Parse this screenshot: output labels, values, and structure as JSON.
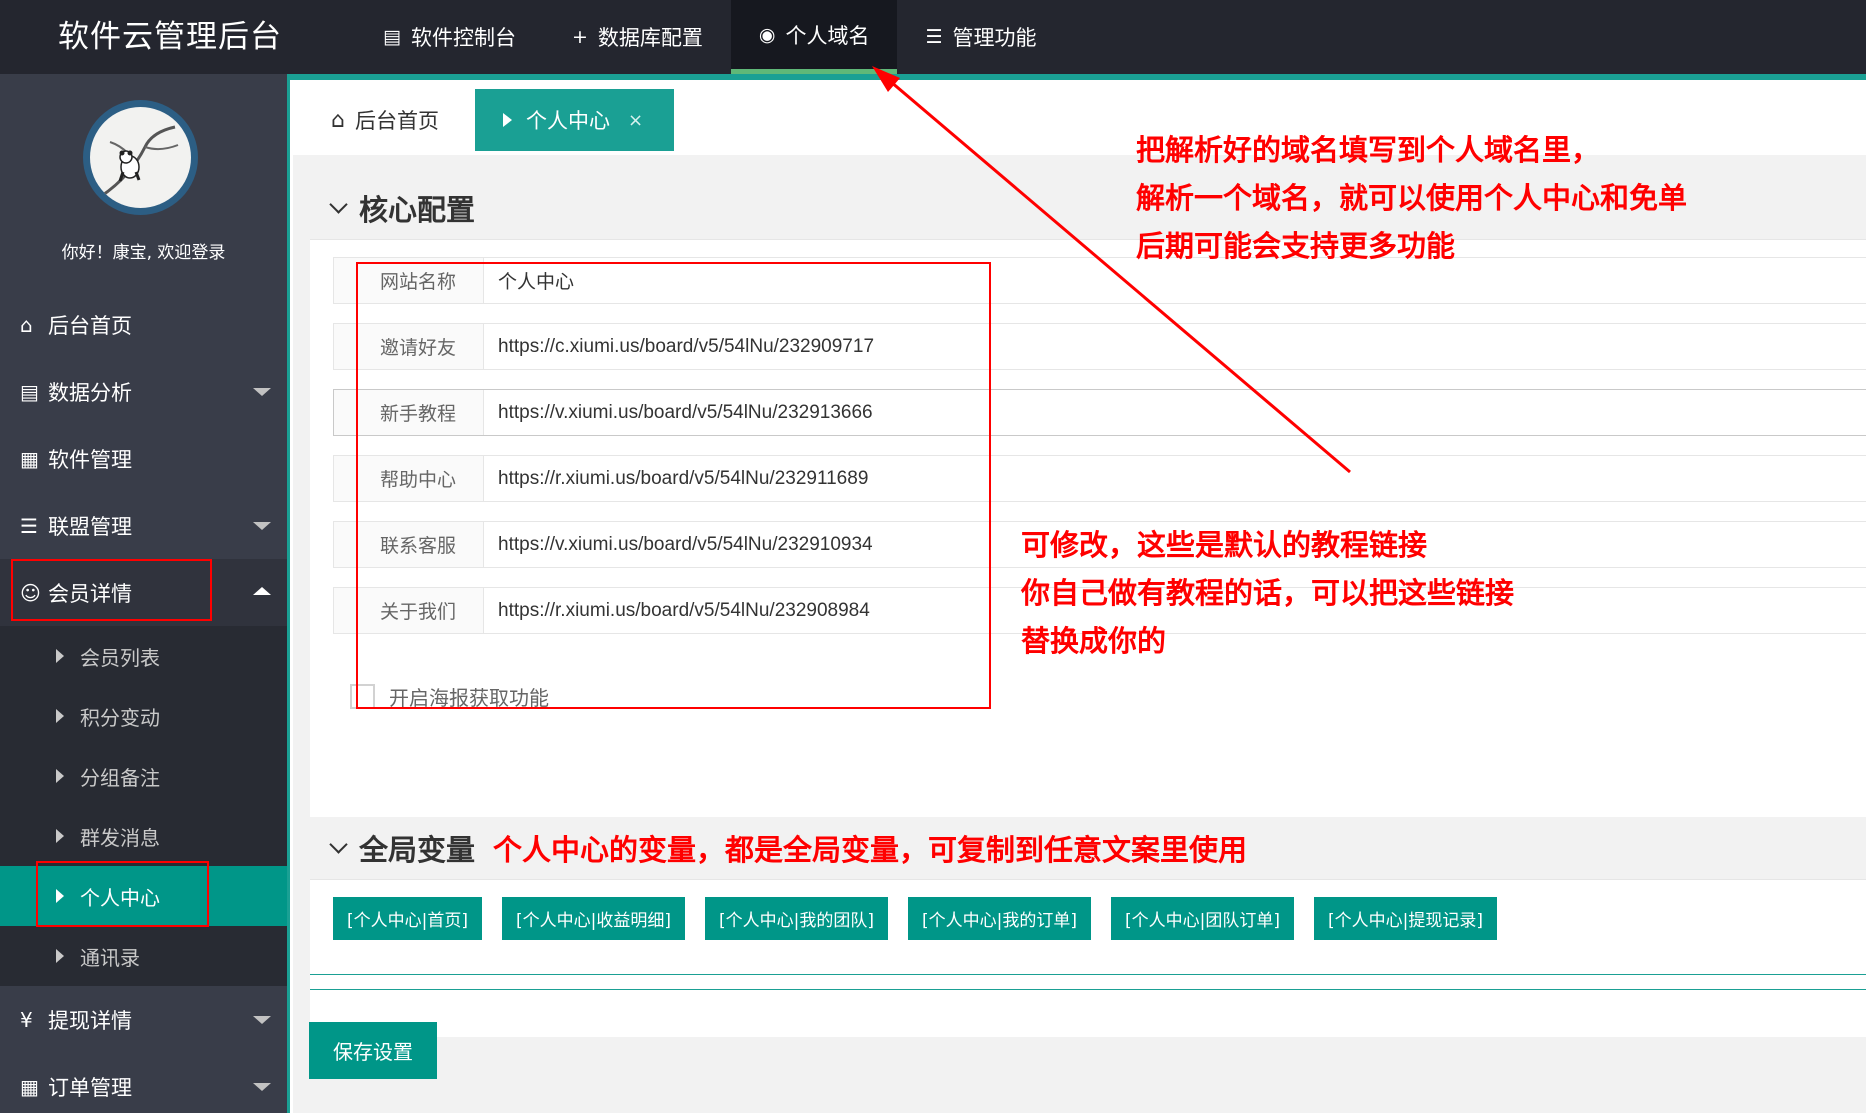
{
  "header": {
    "brand": "软件云管理后台",
    "nav": [
      {
        "icon": "document-icon",
        "label": "软件控制台"
      },
      {
        "icon": "plus-icon",
        "label": "数据库配置"
      },
      {
        "icon": "globe-icon",
        "label": "个人域名",
        "active": true
      },
      {
        "icon": "layers-icon",
        "label": "管理功能"
      }
    ]
  },
  "sidebar": {
    "welcome": "你好！康宝, 欢迎登录",
    "menu": [
      {
        "icon": "home-icon",
        "label": "后台首页"
      },
      {
        "icon": "book-icon",
        "label": "数据分析"
      },
      {
        "icon": "grid-icon",
        "label": "软件管理"
      },
      {
        "icon": "list-icon",
        "label": "联盟管理"
      },
      {
        "icon": "user-icon",
        "label": "会员详情"
      },
      {
        "icon": "yen-icon",
        "label": "提现详情"
      },
      {
        "icon": "table-icon",
        "label": "订单管理"
      }
    ],
    "submenu": [
      "会员列表",
      "积分变动",
      "分组备注",
      "群发消息",
      "个人中心",
      "通讯录"
    ]
  },
  "tabs": {
    "home": "后台首页",
    "active": "个人中心",
    "close": "×"
  },
  "core_config": {
    "title": "核心配置",
    "fields": [
      {
        "label": "网站名称",
        "value": "个人中心"
      },
      {
        "label": "邀请好友",
        "value": "https://c.xiumi.us/board/v5/54lNu/232909717"
      },
      {
        "label": "新手教程",
        "value": "https://v.xiumi.us/board/v5/54lNu/232913666"
      },
      {
        "label": "帮助中心",
        "value": "https://r.xiumi.us/board/v5/54lNu/232911689"
      },
      {
        "label": "联系客服",
        "value": "https://v.xiumi.us/board/v5/54lNu/232910934"
      },
      {
        "label": "关于我们",
        "value": "https://r.xiumi.us/board/v5/54lNu/232908984"
      }
    ],
    "poster_checkbox": "开启海报获取功能"
  },
  "global_vars": {
    "title": "全局变量",
    "note": "个人中心的变量，都是全局变量，可复制到任意文案里使用",
    "buttons": [
      "[个人中心|首页]",
      "[个人中心|收益明细]",
      "[个人中心|我的团队]",
      "[个人中心|我的订单]",
      "[个人中心|团队订单]",
      "[个人中心|提现记录]"
    ]
  },
  "save_button": "保存设置",
  "annotations": {
    "top": [
      "把解析好的域名填写到个人域名里，",
      "解析一个域名，就可以使用个人中心和免单",
      "后期可能会支持更多功能"
    ],
    "middle": [
      "可修改，这些是默认的教程链接",
      "你自己做有教程的话，可以把这些链接",
      "替换成你的"
    ]
  },
  "colors": {
    "topbar": "#24262f",
    "sidebar": "#393d49",
    "accent": "#009688",
    "annotation": "#ff0000"
  }
}
